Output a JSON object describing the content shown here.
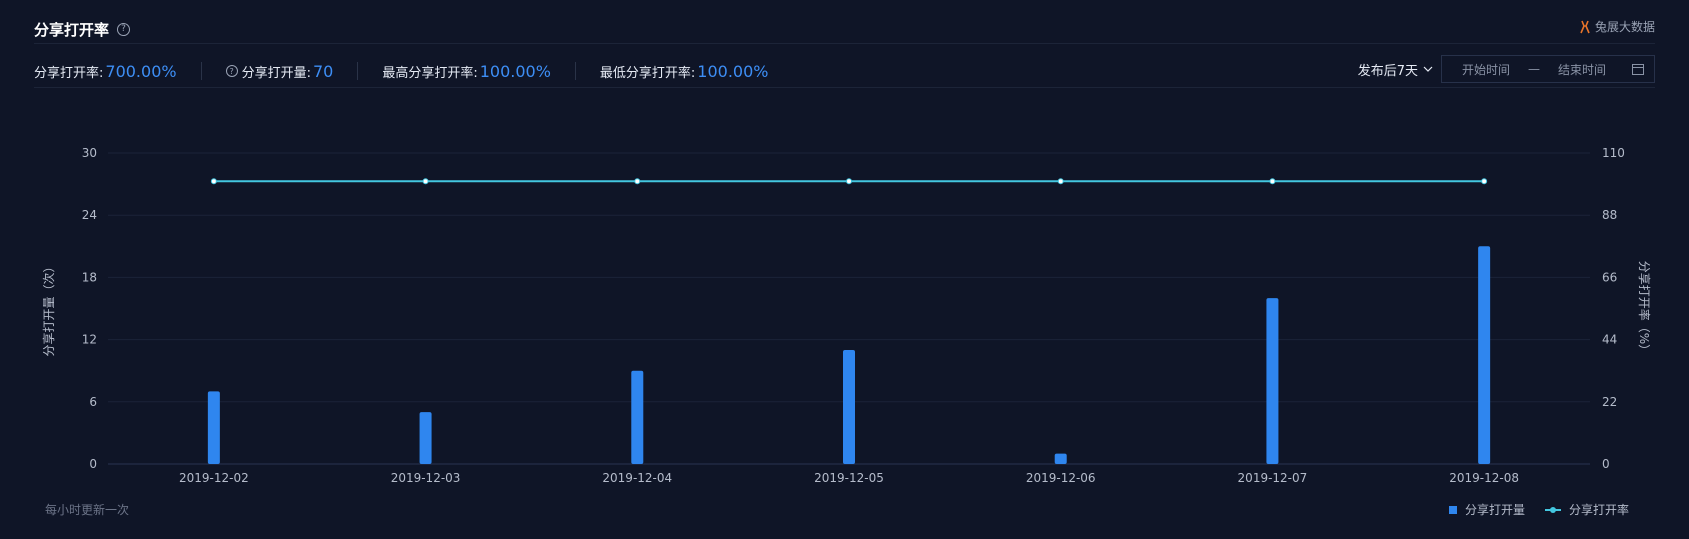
{
  "header": {
    "title": "分享打开率",
    "help_icon": "?",
    "brand": "兔展大数据"
  },
  "stats": {
    "share_open_rate_label": "分享打开率:",
    "share_open_rate_value": "700.00%",
    "share_open_count_label": "分享打开量:",
    "share_open_count_value": "70",
    "max_rate_label": "最高分享打开率:",
    "max_rate_value": "100.00%",
    "min_rate_label": "最低分享打开率:",
    "min_rate_value": "100.00%"
  },
  "filter": {
    "period": "发布后7天",
    "start_placeholder": "开始时间",
    "separator": "—",
    "end_placeholder": "结束时间"
  },
  "footer": {
    "note": "每小时更新一次"
  },
  "legend": {
    "bar_label": "分享打开量",
    "line_label": "分享打开率"
  },
  "colors": {
    "bar": "#2f86ef",
    "line": "#43c7e0",
    "accent": "#3d8ef5",
    "background": "#0f1527"
  },
  "chart_data": {
    "type": "bar",
    "categories": [
      "2019-12-02",
      "2019-12-03",
      "2019-12-04",
      "2019-12-05",
      "2019-12-06",
      "2019-12-07",
      "2019-12-08"
    ],
    "series": [
      {
        "name": "分享打开量",
        "type": "bar",
        "axis": "left",
        "values": [
          7,
          5,
          9,
          11,
          1,
          16,
          21
        ]
      },
      {
        "name": "分享打开率",
        "type": "line",
        "axis": "right",
        "values": [
          100,
          100,
          100,
          100,
          100,
          100,
          100
        ]
      }
    ],
    "ylabel": "分享打开量（次）",
    "ylim": [
      0,
      30
    ],
    "yticks": [
      0,
      6,
      12,
      18,
      24,
      30
    ],
    "y2label": "分享打开率（%）",
    "y2lim": [
      0,
      110
    ],
    "y2ticks": [
      0,
      22,
      44,
      66,
      88,
      110
    ],
    "grid": true,
    "legend_position": "bottom-right"
  }
}
